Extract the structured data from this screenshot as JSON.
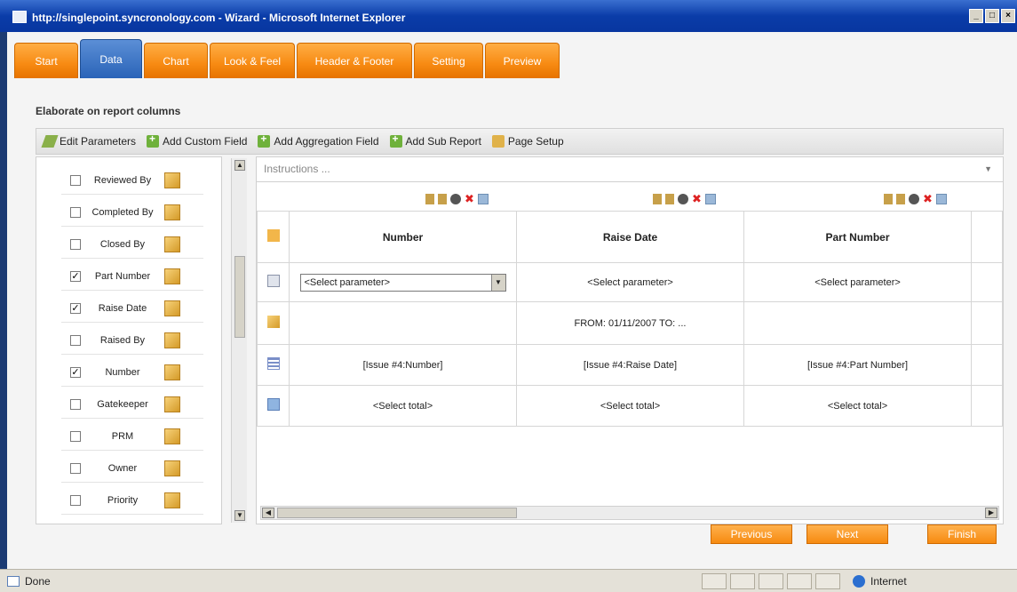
{
  "window": {
    "title": "http://singlepoint.syncronology.com - Wizard - Microsoft Internet Explorer",
    "min": "_",
    "max": "□",
    "close": "×"
  },
  "tabs": [
    {
      "label": "Start"
    },
    {
      "label": "Data"
    },
    {
      "label": "Chart"
    },
    {
      "label": "Look & Feel"
    },
    {
      "label": "Header & Footer"
    },
    {
      "label": "Setting"
    },
    {
      "label": "Preview"
    }
  ],
  "active_tab": "Data",
  "section_title": "Elaborate on report columns",
  "toolbar": {
    "edit_parameters": "Edit Parameters",
    "add_custom_field": "Add Custom Field",
    "add_aggregation_field": "Add Aggregation Field",
    "add_sub_report": "Add Sub Report",
    "page_setup": "Page Setup"
  },
  "columns_list": [
    {
      "label": "Reviewed By",
      "checked": false
    },
    {
      "label": "Completed By",
      "checked": false
    },
    {
      "label": "Closed By",
      "checked": false
    },
    {
      "label": "Part Number",
      "checked": true
    },
    {
      "label": "Raise Date",
      "checked": true
    },
    {
      "label": "Raised By",
      "checked": false
    },
    {
      "label": "Number",
      "checked": true
    },
    {
      "label": "Gatekeeper",
      "checked": false
    },
    {
      "label": "PRM",
      "checked": false
    },
    {
      "label": "Owner",
      "checked": false
    },
    {
      "label": "Priority",
      "checked": false
    }
  ],
  "check_mark": "✓",
  "instructions": {
    "placeholder": "Instructions ...",
    "dropdown": "▼"
  },
  "grid": {
    "headers": [
      "Number",
      "Raise Date",
      "Part Number"
    ],
    "parameter_row": {
      "select_value": "<Select parameter>",
      "cells": [
        "<Select parameter>",
        "<Select parameter>"
      ]
    },
    "filter_row": [
      "",
      "FROM: 01/11/2007 TO: ...",
      ""
    ],
    "detail_row": [
      "[Issue #4:Number]",
      "[Issue #4:Raise Date]",
      "[Issue #4:Part Number]"
    ],
    "total_row": [
      "<Select total>",
      "<Select total>",
      "<Select total>"
    ]
  },
  "buttons": {
    "previous": "Previous",
    "next": "Next",
    "finish": "Finish"
  },
  "statusbar": {
    "status": "Done",
    "zone": "Internet"
  },
  "colors": {
    "tab_orange": "#f78a12",
    "tab_active_blue": "#2a64b8",
    "title_blue": "#0a3ca8"
  }
}
